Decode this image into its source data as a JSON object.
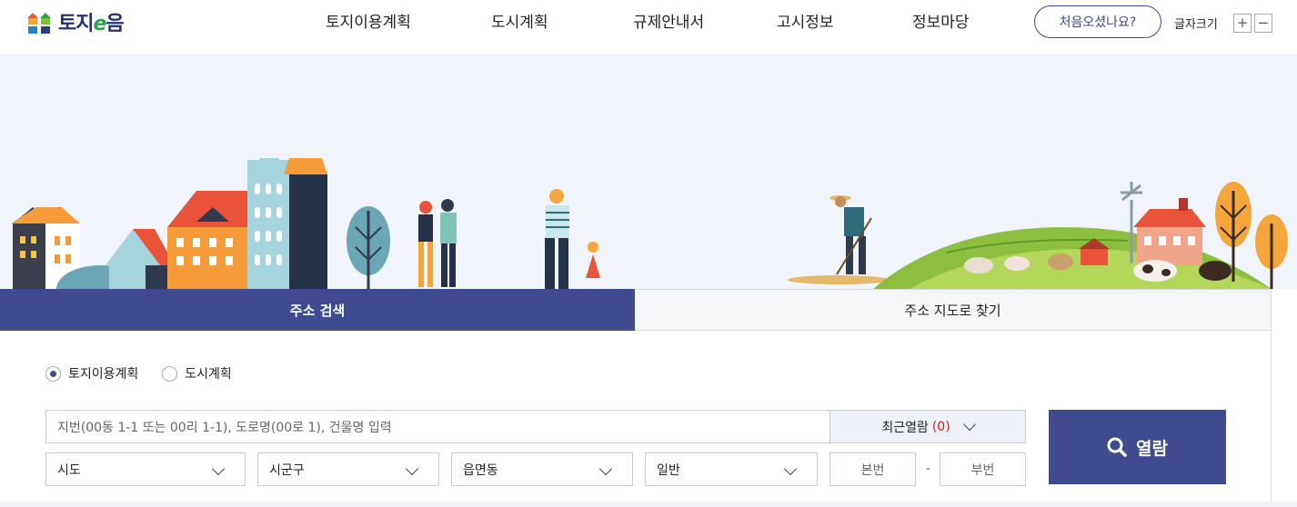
{
  "logo": {
    "text_prefix": "토지",
    "text_e": "e",
    "text_suffix": "음"
  },
  "nav": [
    "토지이용계획",
    "도시계획",
    "규제안내서",
    "고시정보",
    "정보마당"
  ],
  "header": {
    "first_visit": "처음오셨나요?",
    "font_size_label": "글자크기",
    "plus": "+",
    "minus": "−"
  },
  "tabs": {
    "address_search": "주소 검색",
    "map_search": "주소 지도로 찾기"
  },
  "radios": {
    "land_use": "토지이용계획",
    "urban": "도시계획",
    "selected": "토지이용계획"
  },
  "search": {
    "placeholder": "지번(00동 1-1 또는 00리 1-1), 도로명(00로 1), 건물명 입력"
  },
  "recent": {
    "label": "최근열람",
    "count": "(0)"
  },
  "selects": {
    "sido": "시도",
    "sigungu": "시군구",
    "eupmyeondong": "읍면동",
    "type": "일반"
  },
  "lot": {
    "main": "본번",
    "dash": "-",
    "sub": "부번"
  },
  "open_button": "열람",
  "colors": {
    "primary": "#3f4a8f",
    "accent_red": "#d21d1d"
  }
}
